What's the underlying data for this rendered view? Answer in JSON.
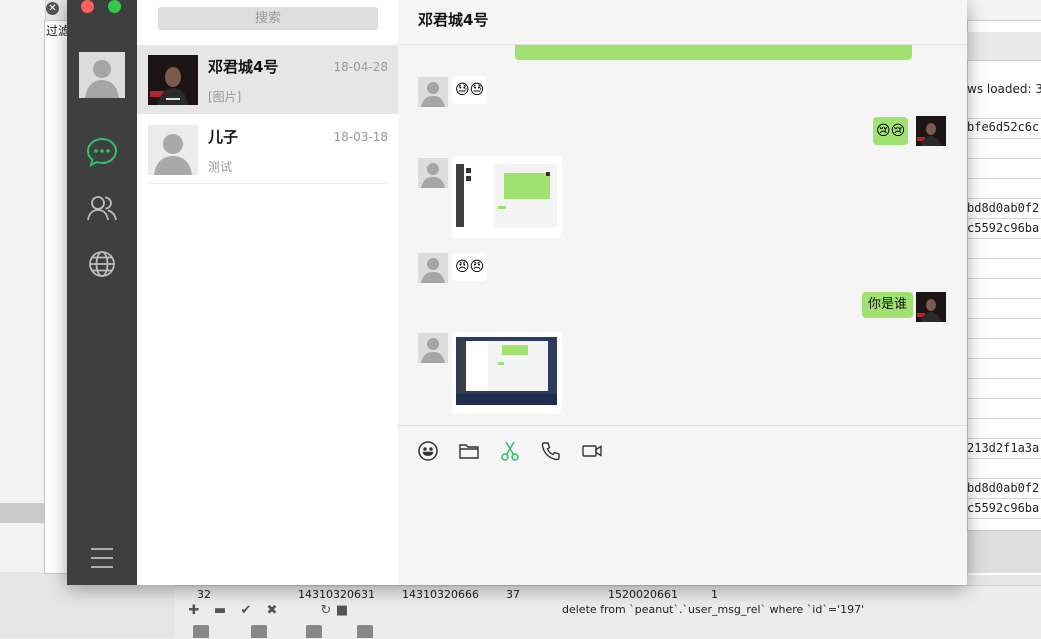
{
  "background_app": {
    "filter_label": "过滤",
    "rows_loaded_text": "ws loaded: 3",
    "cells": [
      "bfe6d52c6c",
      "bd8d0ab0f2",
      "c5592c96ba",
      "213d2f1a3a",
      "bd8d0ab0f2",
      "c5592c96ba"
    ],
    "bottom_row": [
      "32",
      "14310320631",
      "14310320666",
      "37",
      "1520020661",
      "1"
    ],
    "sql_text": "delete from `peanut`.`user_msg_rel` where `id`='197'"
  },
  "wechat": {
    "search_placeholder": "搜索",
    "conversations": [
      {
        "name": "邓君城4号",
        "time": "18-04-28",
        "preview": "[图片]"
      },
      {
        "name": "儿子",
        "time": "18-03-18",
        "preview": "测试"
      }
    ],
    "chat": {
      "title": "邓君城4号",
      "messages": [
        {
          "side": "left",
          "type": "emoji",
          "content": "😓😓"
        },
        {
          "side": "right",
          "type": "emoji",
          "content": "😢😢"
        },
        {
          "side": "left",
          "type": "image",
          "content": ""
        },
        {
          "side": "left",
          "type": "emoji",
          "content": "😠😠"
        },
        {
          "side": "right",
          "type": "text",
          "content": "你是谁"
        },
        {
          "side": "left",
          "type": "image",
          "content": ""
        }
      ]
    },
    "toolbar_icons": [
      "emoji-icon",
      "folder-icon",
      "scissors-icon",
      "phone-icon",
      "video-icon"
    ],
    "accent_color": "#2dc170",
    "bubble_color": "#a0e26f"
  }
}
